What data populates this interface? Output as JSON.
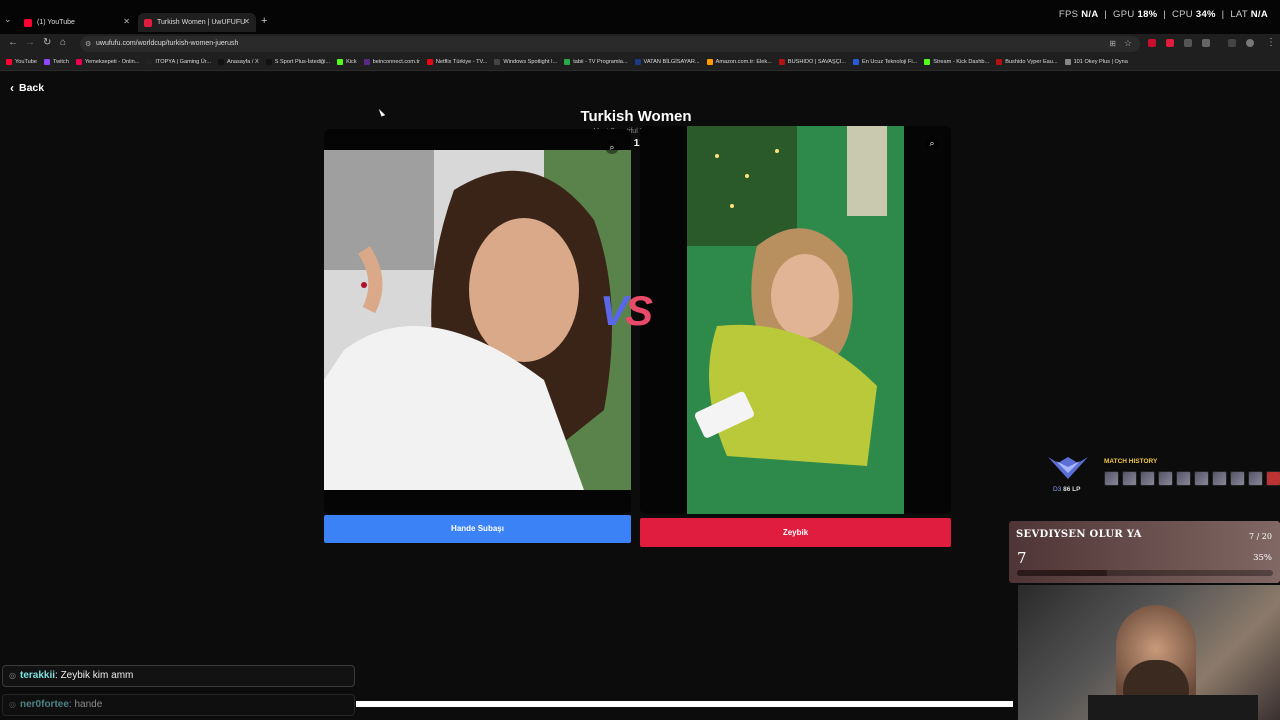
{
  "browser": {
    "tabs": [
      {
        "title": "(1) YouTube",
        "favicon_color": "#ff0033"
      },
      {
        "title": "Turkish Women | UwUFUFU",
        "favicon_color": "#e11d3f"
      }
    ],
    "perf": {
      "fps_label": "FPS",
      "fps": "N/A",
      "gpu_label": "GPU",
      "gpu": "18%",
      "cpu_label": "CPU",
      "cpu": "34%",
      "lat_label": "LAT",
      "lat": "N/A"
    },
    "url": "uwufufu.com/worldcup/turkish-women-juerush",
    "bookmarks": [
      {
        "label": "YouTube",
        "color": "#ff0033"
      },
      {
        "label": "Twitch",
        "color": "#9146ff"
      },
      {
        "label": "Yemeksepeti - Onlin...",
        "color": "#ea004b"
      },
      {
        "label": "ITOPYA | Gaming Ür...",
        "color": "#222222"
      },
      {
        "label": "Anasayfa / X",
        "color": "#111111"
      },
      {
        "label": "S Sport Plus-İstediği...",
        "color": "#111111"
      },
      {
        "label": "Kick",
        "color": "#53fc18"
      },
      {
        "label": "beinconnect.com.tr",
        "color": "#5b2a86"
      },
      {
        "label": "Netflix Türkiye - TV...",
        "color": "#e50914"
      },
      {
        "label": "Windows Spotlight I...",
        "color": "#444444"
      },
      {
        "label": "tabii - TV Programla...",
        "color": "#2aa84a"
      },
      {
        "label": "VATAN BİLGİSAYAR...",
        "color": "#1a3a8a"
      },
      {
        "label": "Amazon.com.tr: Elek...",
        "color": "#ff9900"
      },
      {
        "label": "BUSHIDO | SAVAŞÇI...",
        "color": "#b11212"
      },
      {
        "label": "En Ucuz Teknoloji Fi...",
        "color": "#2a5ad8"
      },
      {
        "label": "Stream - Kick Dashb...",
        "color": "#53fc18"
      },
      {
        "label": "Bushido Vyper Eau...",
        "color": "#b11212"
      },
      {
        "label": "101 Okey Plus | Oyna",
        "color": "#888888"
      }
    ]
  },
  "page": {
    "back_label": "Back",
    "title": "Turkish Women",
    "subtitle": "Most Beautiful Turkish Girls",
    "round": "Rounds of 128 Match 2",
    "vs_v": "V",
    "vs_s": "S",
    "left_name": "Hande Subaşı",
    "right_name": "Zeybik"
  },
  "overlay": {
    "chat": [
      {
        "user": "terakkii",
        "text": ": Zeybik kim amm"
      },
      {
        "user": "ner0fortee",
        "text": ": hande"
      }
    ],
    "rank": {
      "tier": "D3",
      "lp": "86 LP"
    },
    "match_history_title": "MATCH HISTORY",
    "song": {
      "title": "SEVDIYSEN OLUR YA",
      "count": "7 / 20",
      "level": "7",
      "percent": "35%",
      "fill": 0.35
    }
  }
}
